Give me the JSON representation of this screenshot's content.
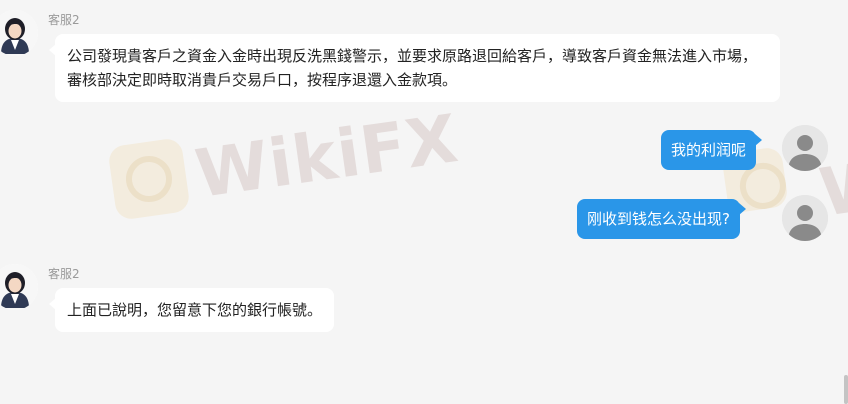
{
  "watermark": {
    "text": "WikiFX",
    "secondary_text": "W"
  },
  "messages": [
    {
      "side": "in",
      "sender": "客服2",
      "text": "公司發現貴客戶之資金入金時出現反洗黑錢警示，並要求原路退回給客戶，導致客戶資金無法進入市場，審核部決定即時取消貴戶交易戶口，按程序退還入金款項。"
    },
    {
      "side": "out",
      "text": "我的利润呢"
    },
    {
      "side": "out",
      "text": "刚收到钱怎么没出现?"
    },
    {
      "side": "in",
      "sender": "客服2",
      "text": "上面已說明，您留意下您的銀行帳號。"
    }
  ],
  "colors": {
    "outgoing_bubble": "#2a96e8",
    "incoming_bubble": "#ffffff",
    "background": "#f5f5f5"
  },
  "icons": {
    "agent_avatar": "agent-avatar-icon",
    "user_avatar": "user-avatar-icon"
  }
}
